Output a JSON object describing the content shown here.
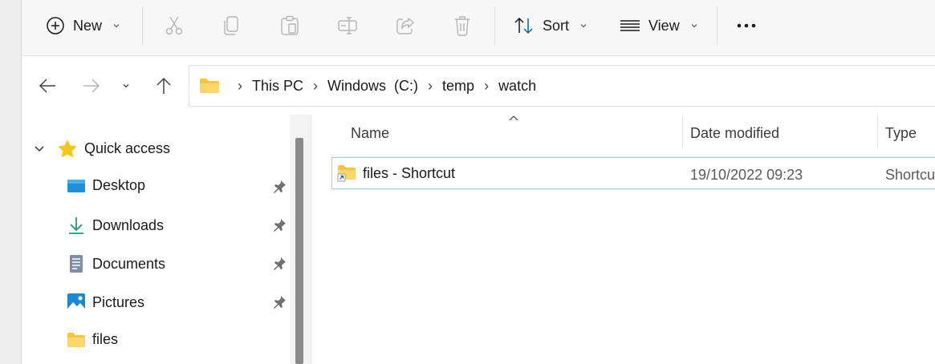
{
  "toolbar": {
    "new_label": "New",
    "sort_label": "Sort",
    "view_label": "View"
  },
  "breadcrumb": [
    "This PC",
    "Windows  (C:)",
    "temp",
    "watch"
  ],
  "sidebar": {
    "quick_access": "Quick access",
    "items": [
      {
        "label": "Desktop",
        "pinned": true
      },
      {
        "label": "Downloads",
        "pinned": true
      },
      {
        "label": "Documents",
        "pinned": true
      },
      {
        "label": "Pictures",
        "pinned": true
      },
      {
        "label": "files",
        "pinned": false
      }
    ]
  },
  "columns": {
    "name": "Name",
    "date_modified": "Date modified",
    "type": "Type"
  },
  "files": [
    {
      "name": "files - Shortcut",
      "date_modified": "19/10/2022 09:23",
      "type": "Shortcut"
    }
  ],
  "colors": {
    "accent": "#0067c0",
    "folder": "#f8c43a",
    "selection_border": "#9fd3d9"
  }
}
